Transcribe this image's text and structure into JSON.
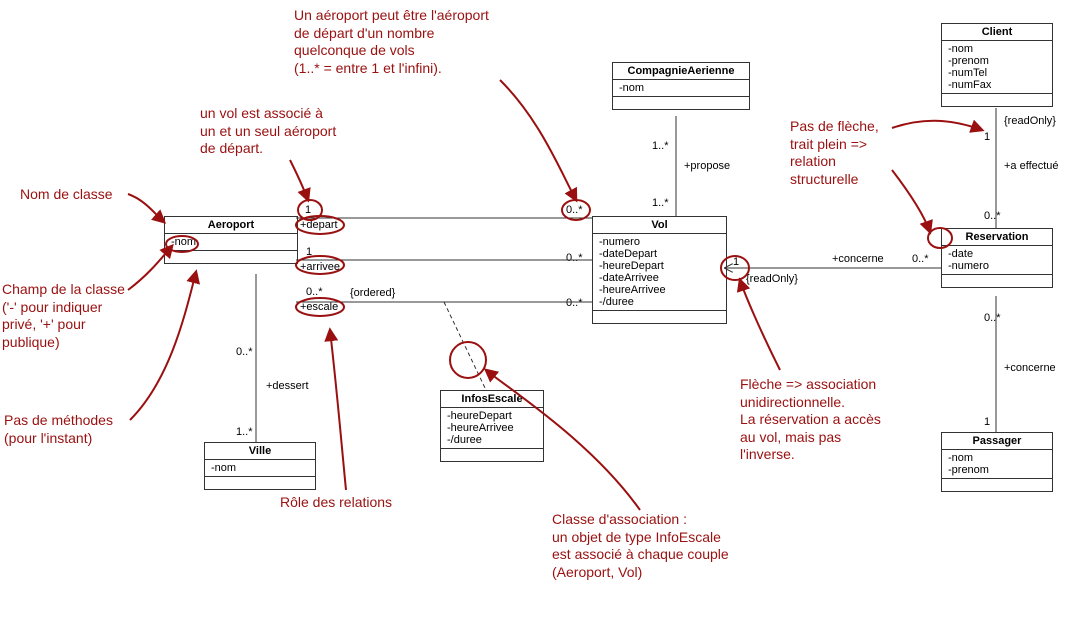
{
  "classes": {
    "aeroport": {
      "name": "Aeroport",
      "attrs": [
        "-nom"
      ]
    },
    "compagnie": {
      "name": "CompagnieAerienne",
      "attrs": [
        "-nom"
      ]
    },
    "vol": {
      "name": "Vol",
      "attrs": [
        "-numero",
        "-dateDepart",
        "-heureDepart",
        "-dateArrivee",
        "-heureArrivee",
        "-/duree"
      ]
    },
    "infosescale": {
      "name": "InfosEscale",
      "attrs": [
        "-heureDepart",
        "-heureArrivee",
        "-/duree"
      ]
    },
    "ville": {
      "name": "Ville",
      "attrs": [
        "-nom"
      ]
    },
    "client": {
      "name": "Client",
      "attrs": [
        "-nom",
        "-prenom",
        "-numTel",
        "-numFax"
      ]
    },
    "reservation": {
      "name": "Reservation",
      "attrs": [
        "-date",
        "-numero"
      ]
    },
    "passager": {
      "name": "Passager",
      "attrs": [
        "-nom",
        "-prenom"
      ]
    }
  },
  "labels": {
    "depart": "+depart",
    "arrivee": "+arrivee",
    "escale": "+escale",
    "ordered": "{ordered}",
    "dessert": "+dessert",
    "propose": "+propose",
    "concerne": "+concerne",
    "concerne2": "+concerne",
    "aeffectue": "+a effectué",
    "readOnly": "{readOnly}",
    "readOnly2": "{readOnly}"
  },
  "mult": {
    "m1": "1",
    "m1star": "1..*",
    "m0star": "0..*"
  },
  "annotations": {
    "a1": "Un aéroport peut être l'aéroport\nde départ d'un nombre\nquelconque de vols\n(1..* = entre 1 et l'infini).",
    "a2": "un vol est associé à\nun et un seul aéroport\nde départ.",
    "a3": "Nom de classe",
    "a4": "Champ de la classe\n('-' pour indiquer\nprivé, '+' pour\npublique)",
    "a5": "Pas de méthodes\n(pour l'instant)",
    "a6": "Rôle des relations",
    "a7": "Classe d'association :\nun objet de type InfoEscale\nest associé à chaque couple\n(Aeroport, Vol)",
    "a8": "Flèche => association\nunidirectionnelle.\nLa réservation a accès\nau vol, mais pas\nl'inverse.",
    "a9": "Pas de flèche,\ntrait plein =>\nrelation\nstructurelle"
  }
}
